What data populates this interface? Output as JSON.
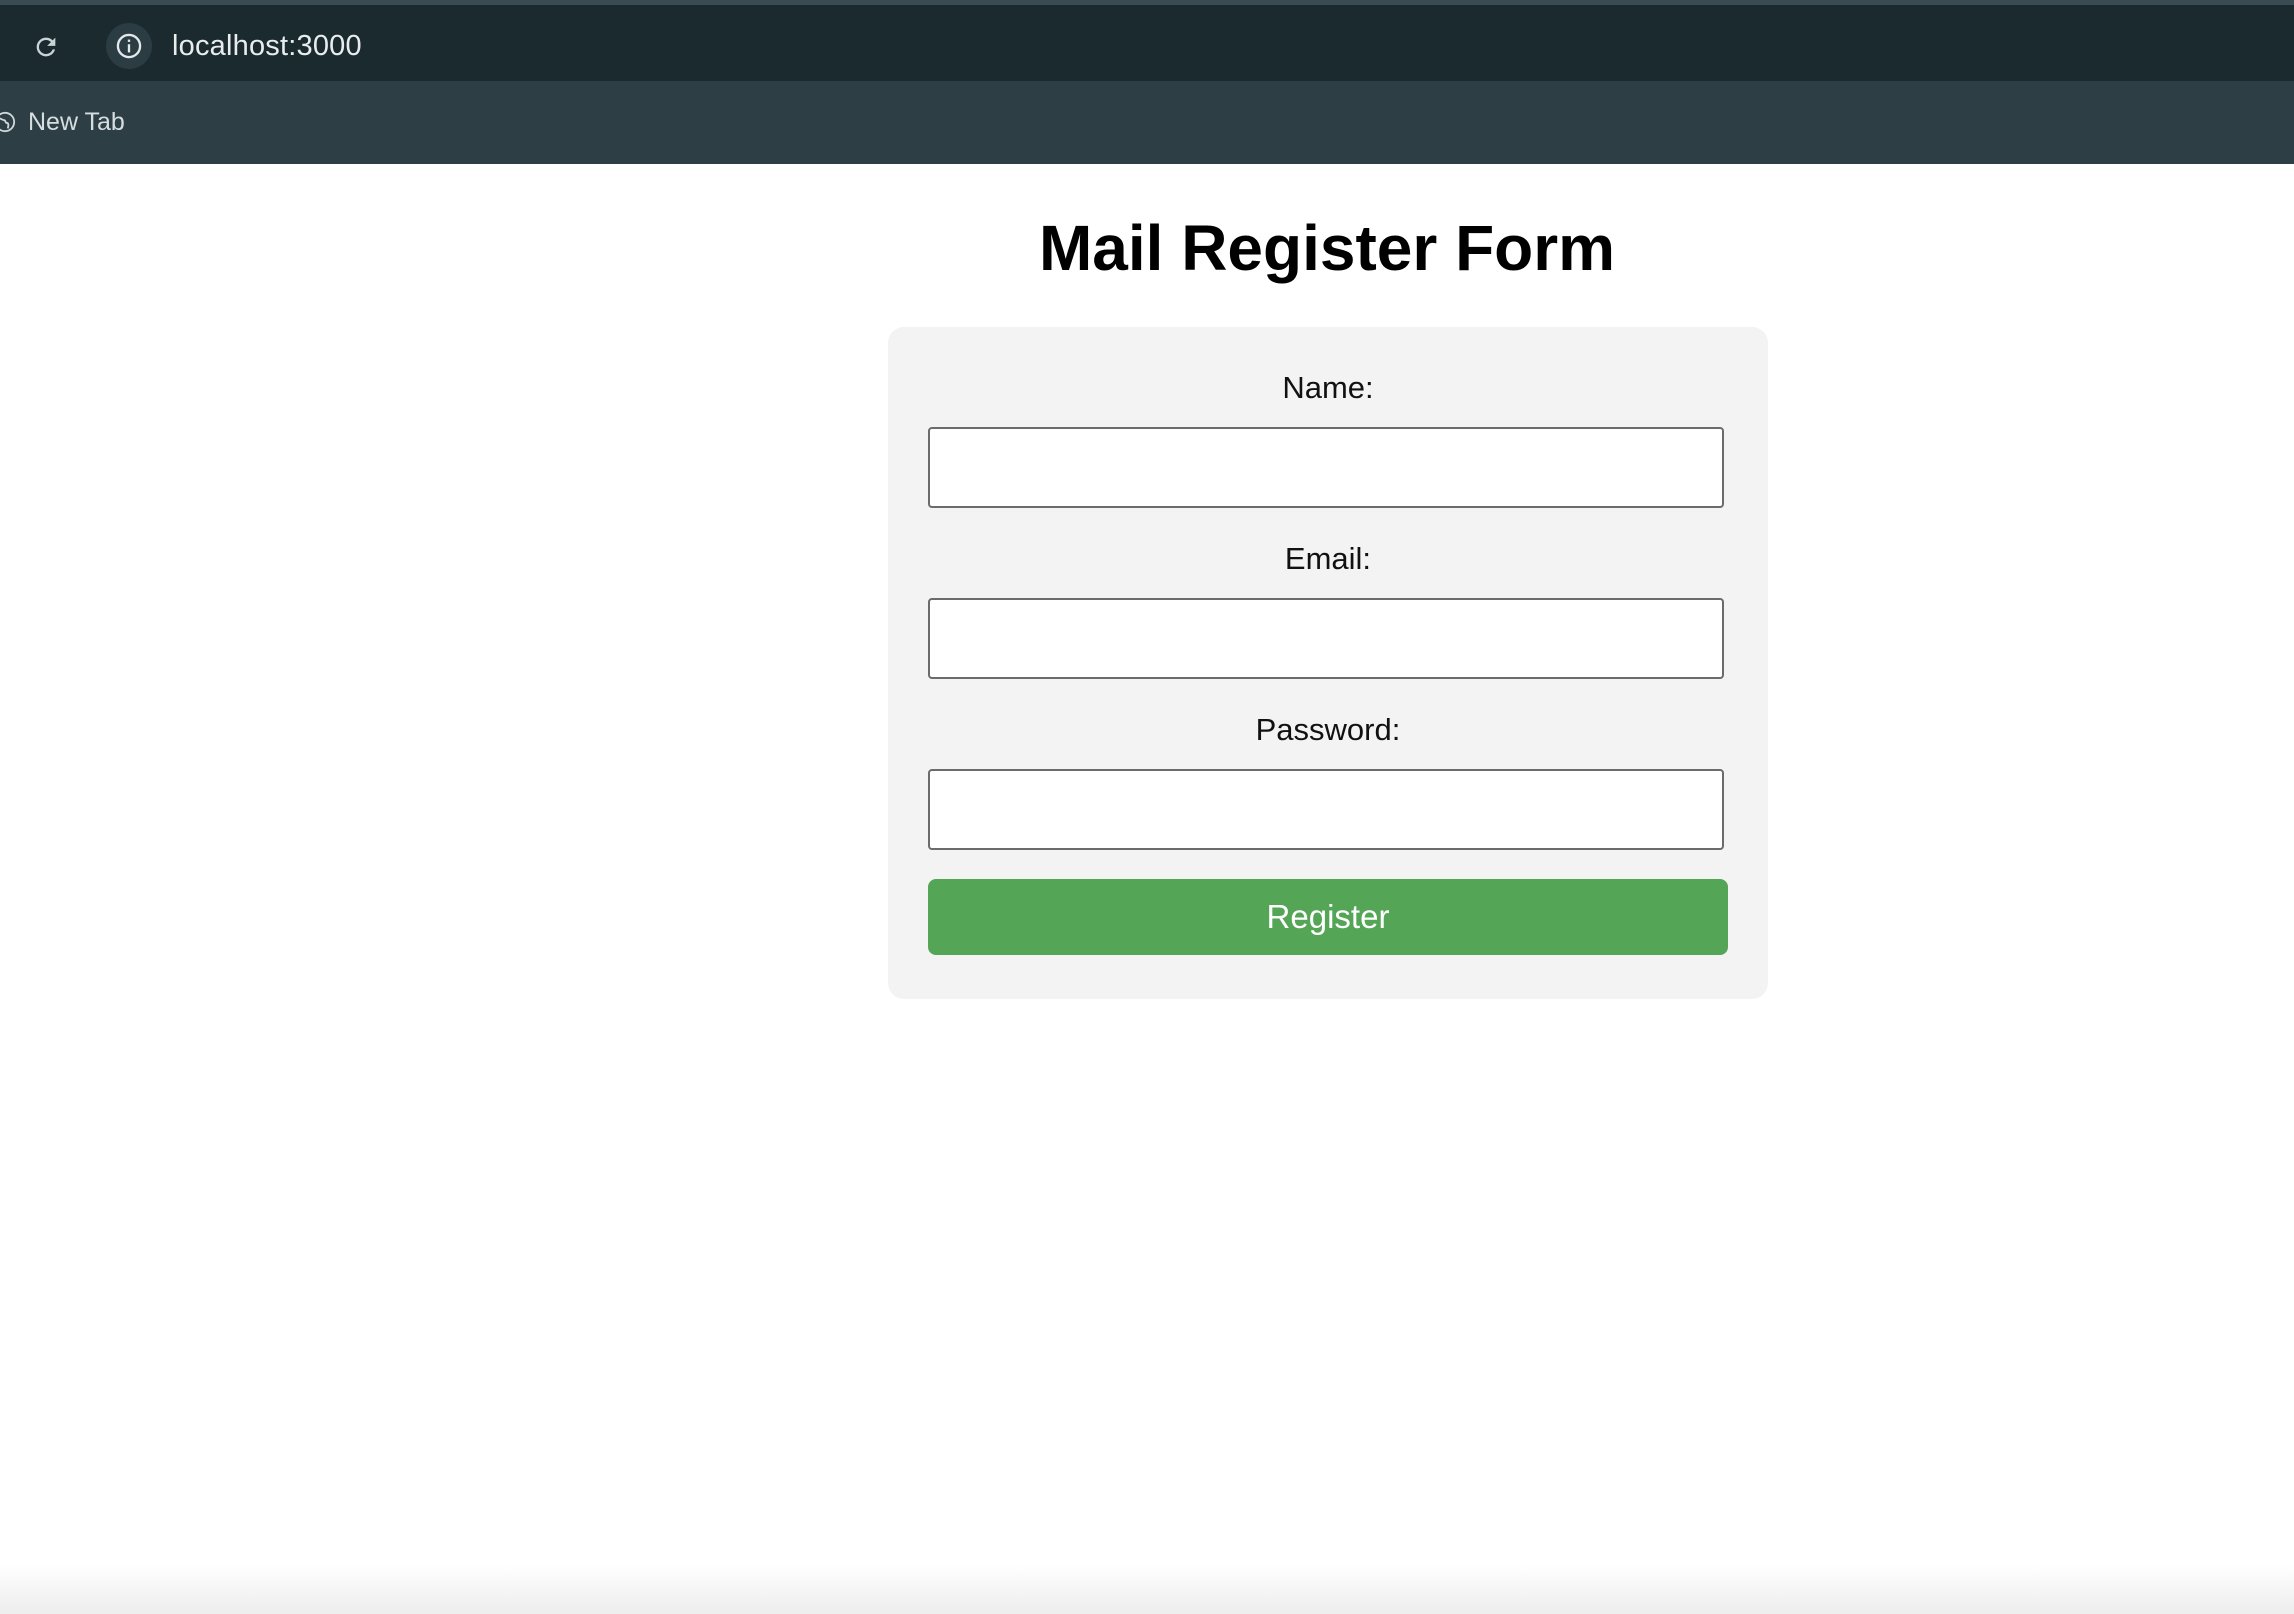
{
  "browser": {
    "url": "localhost:3000",
    "bookmarks": [
      {
        "label": "New Tab",
        "icon": "globe-icon"
      }
    ],
    "toolbar_color": "#1b2a2f",
    "bar_color": "#2d3e44"
  },
  "page": {
    "title": "Mail Register Form",
    "form": {
      "fields": [
        {
          "label": "Name:",
          "value": ""
        },
        {
          "label": "Email:",
          "value": ""
        },
        {
          "label": "Password:",
          "value": ""
        }
      ],
      "submit_label": "Register",
      "submit_color": "#55a556"
    }
  }
}
